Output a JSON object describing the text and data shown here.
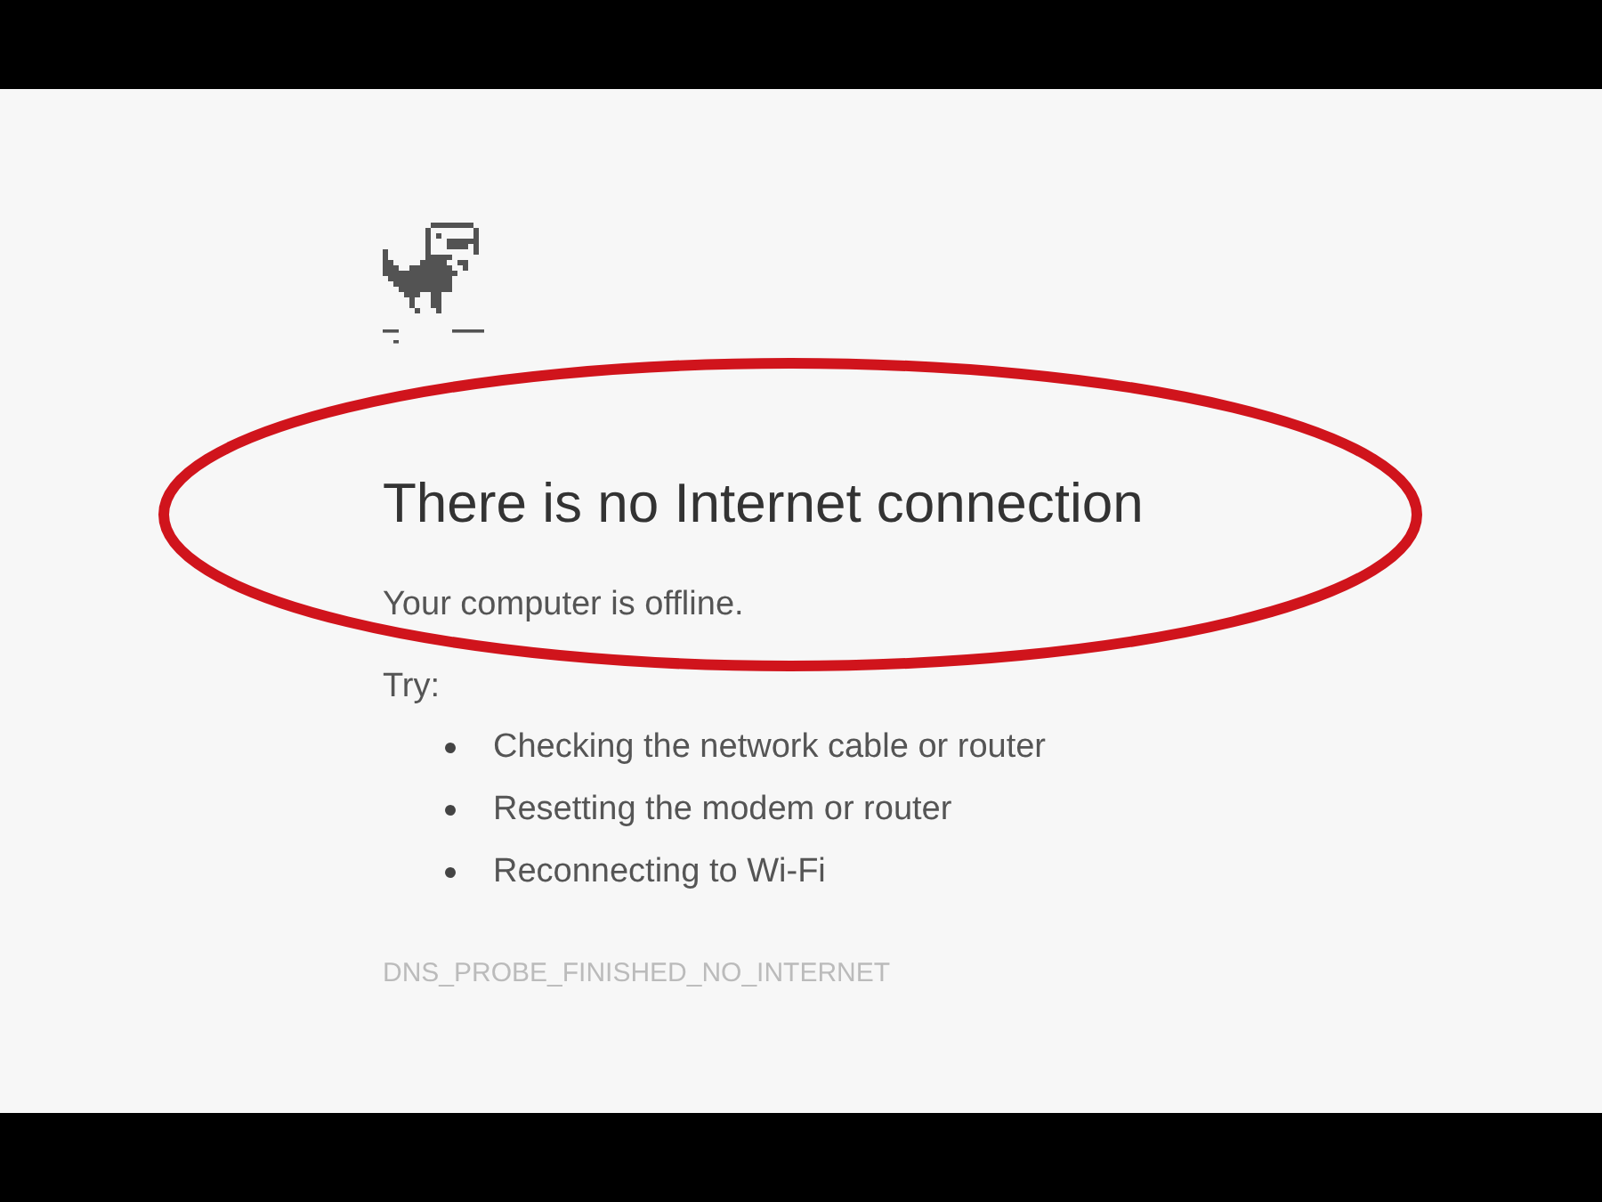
{
  "heading": "There is no Internet connection",
  "message": "Your computer is offline.",
  "try_label": "Try:",
  "suggestions": [
    "Checking the network cable or router",
    "Resetting the modem or router",
    "Reconnecting to Wi-Fi"
  ],
  "error_code": "DNS_PROBE_FINISHED_NO_INTERNET"
}
